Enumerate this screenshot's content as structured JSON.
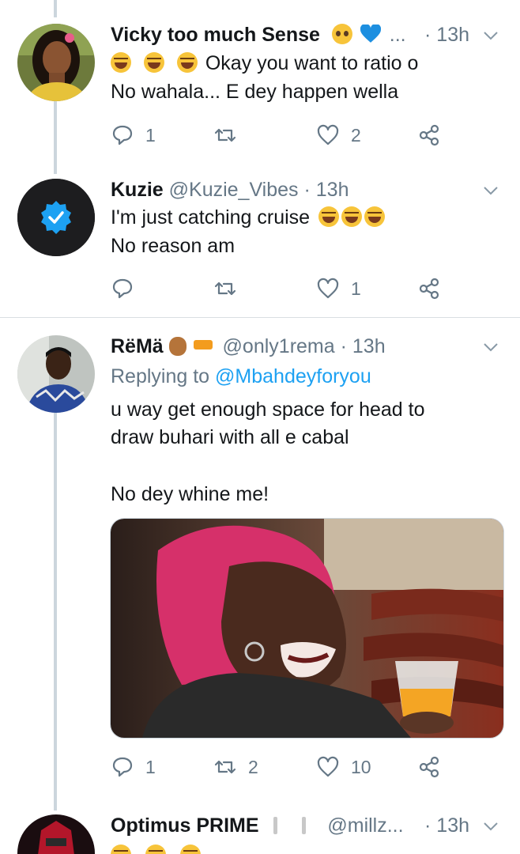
{
  "colors": {
    "accent": "#1da1f2",
    "muted": "#657786",
    "text": "#14171a",
    "thread": "#ccd6dd"
  },
  "tweets": [
    {
      "name": "Vicky too much Sense",
      "handle": "...",
      "time": "· 13h",
      "lines": [
        "Okay you want to ratio o",
        "No wahala... E dey happen wella"
      ],
      "replies": "1",
      "retweets": "",
      "likes": "2"
    },
    {
      "name": "Kuzie",
      "handle": "@Kuzie_Vibes",
      "time": "· 13h",
      "lines": [
        "I'm just catching cruise",
        "No reason am"
      ],
      "replies": "",
      "retweets": "",
      "likes": "1"
    },
    {
      "name": "RëMä",
      "handle": "@only1rema",
      "time": "· 13h",
      "replying_prefix": "Replying to",
      "replying_to": "@Mbahdeyforyou",
      "lines": [
        "u way get enough space for head to",
        "draw buhari with all e cabal",
        "No dey whine me!"
      ],
      "media_alt": "laughing woman with red hair holding a drink",
      "replies": "1",
      "retweets": "2",
      "likes": "10"
    },
    {
      "name": "Optimus PRIME",
      "handle": "@millz...",
      "time": "· 13h"
    }
  ]
}
